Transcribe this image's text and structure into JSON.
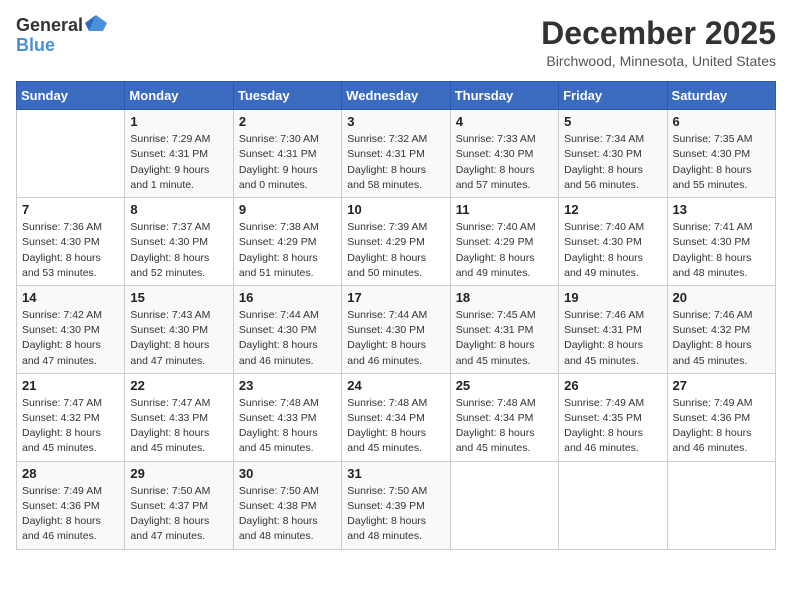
{
  "logo": {
    "general": "General",
    "blue": "Blue"
  },
  "title": "December 2025",
  "location": "Birchwood, Minnesota, United States",
  "days_of_week": [
    "Sunday",
    "Monday",
    "Tuesday",
    "Wednesday",
    "Thursday",
    "Friday",
    "Saturday"
  ],
  "weeks": [
    [
      {
        "day": "",
        "info": ""
      },
      {
        "day": "1",
        "info": "Sunrise: 7:29 AM\nSunset: 4:31 PM\nDaylight: 9 hours\nand 1 minute."
      },
      {
        "day": "2",
        "info": "Sunrise: 7:30 AM\nSunset: 4:31 PM\nDaylight: 9 hours\nand 0 minutes."
      },
      {
        "day": "3",
        "info": "Sunrise: 7:32 AM\nSunset: 4:31 PM\nDaylight: 8 hours\nand 58 minutes."
      },
      {
        "day": "4",
        "info": "Sunrise: 7:33 AM\nSunset: 4:30 PM\nDaylight: 8 hours\nand 57 minutes."
      },
      {
        "day": "5",
        "info": "Sunrise: 7:34 AM\nSunset: 4:30 PM\nDaylight: 8 hours\nand 56 minutes."
      },
      {
        "day": "6",
        "info": "Sunrise: 7:35 AM\nSunset: 4:30 PM\nDaylight: 8 hours\nand 55 minutes."
      }
    ],
    [
      {
        "day": "7",
        "info": "Sunrise: 7:36 AM\nSunset: 4:30 PM\nDaylight: 8 hours\nand 53 minutes."
      },
      {
        "day": "8",
        "info": "Sunrise: 7:37 AM\nSunset: 4:30 PM\nDaylight: 8 hours\nand 52 minutes."
      },
      {
        "day": "9",
        "info": "Sunrise: 7:38 AM\nSunset: 4:29 PM\nDaylight: 8 hours\nand 51 minutes."
      },
      {
        "day": "10",
        "info": "Sunrise: 7:39 AM\nSunset: 4:29 PM\nDaylight: 8 hours\nand 50 minutes."
      },
      {
        "day": "11",
        "info": "Sunrise: 7:40 AM\nSunset: 4:29 PM\nDaylight: 8 hours\nand 49 minutes."
      },
      {
        "day": "12",
        "info": "Sunrise: 7:40 AM\nSunset: 4:30 PM\nDaylight: 8 hours\nand 49 minutes."
      },
      {
        "day": "13",
        "info": "Sunrise: 7:41 AM\nSunset: 4:30 PM\nDaylight: 8 hours\nand 48 minutes."
      }
    ],
    [
      {
        "day": "14",
        "info": "Sunrise: 7:42 AM\nSunset: 4:30 PM\nDaylight: 8 hours\nand 47 minutes."
      },
      {
        "day": "15",
        "info": "Sunrise: 7:43 AM\nSunset: 4:30 PM\nDaylight: 8 hours\nand 47 minutes."
      },
      {
        "day": "16",
        "info": "Sunrise: 7:44 AM\nSunset: 4:30 PM\nDaylight: 8 hours\nand 46 minutes."
      },
      {
        "day": "17",
        "info": "Sunrise: 7:44 AM\nSunset: 4:30 PM\nDaylight: 8 hours\nand 46 minutes."
      },
      {
        "day": "18",
        "info": "Sunrise: 7:45 AM\nSunset: 4:31 PM\nDaylight: 8 hours\nand 45 minutes."
      },
      {
        "day": "19",
        "info": "Sunrise: 7:46 AM\nSunset: 4:31 PM\nDaylight: 8 hours\nand 45 minutes."
      },
      {
        "day": "20",
        "info": "Sunrise: 7:46 AM\nSunset: 4:32 PM\nDaylight: 8 hours\nand 45 minutes."
      }
    ],
    [
      {
        "day": "21",
        "info": "Sunrise: 7:47 AM\nSunset: 4:32 PM\nDaylight: 8 hours\nand 45 minutes."
      },
      {
        "day": "22",
        "info": "Sunrise: 7:47 AM\nSunset: 4:33 PM\nDaylight: 8 hours\nand 45 minutes."
      },
      {
        "day": "23",
        "info": "Sunrise: 7:48 AM\nSunset: 4:33 PM\nDaylight: 8 hours\nand 45 minutes."
      },
      {
        "day": "24",
        "info": "Sunrise: 7:48 AM\nSunset: 4:34 PM\nDaylight: 8 hours\nand 45 minutes."
      },
      {
        "day": "25",
        "info": "Sunrise: 7:48 AM\nSunset: 4:34 PM\nDaylight: 8 hours\nand 45 minutes."
      },
      {
        "day": "26",
        "info": "Sunrise: 7:49 AM\nSunset: 4:35 PM\nDaylight: 8 hours\nand 46 minutes."
      },
      {
        "day": "27",
        "info": "Sunrise: 7:49 AM\nSunset: 4:36 PM\nDaylight: 8 hours\nand 46 minutes."
      }
    ],
    [
      {
        "day": "28",
        "info": "Sunrise: 7:49 AM\nSunset: 4:36 PM\nDaylight: 8 hours\nand 46 minutes."
      },
      {
        "day": "29",
        "info": "Sunrise: 7:50 AM\nSunset: 4:37 PM\nDaylight: 8 hours\nand 47 minutes."
      },
      {
        "day": "30",
        "info": "Sunrise: 7:50 AM\nSunset: 4:38 PM\nDaylight: 8 hours\nand 48 minutes."
      },
      {
        "day": "31",
        "info": "Sunrise: 7:50 AM\nSunset: 4:39 PM\nDaylight: 8 hours\nand 48 minutes."
      },
      {
        "day": "",
        "info": ""
      },
      {
        "day": "",
        "info": ""
      },
      {
        "day": "",
        "info": ""
      }
    ]
  ]
}
